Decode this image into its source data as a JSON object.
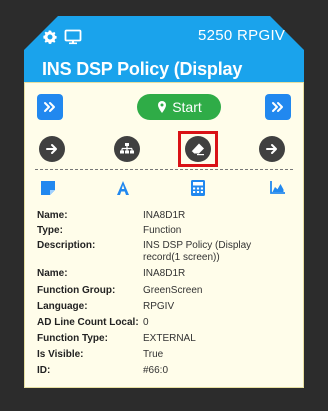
{
  "header": {
    "count": "5250",
    "program": "RPGIV",
    "title": "INS DSP Policy (Display"
  },
  "toolbar": {
    "start_label": "Start"
  },
  "metadata": [
    {
      "label": "Name:",
      "value": "INA8D1R"
    },
    {
      "label": "Type:",
      "value": "Function"
    },
    {
      "label": "Description:",
      "value": "INS DSP Policy (Display\nrecord(1 screen))"
    },
    {
      "label": "Name:",
      "value": "INA8D1R"
    },
    {
      "label": "Function Group:",
      "value": "GreenScreen"
    },
    {
      "label": "Language:",
      "value": "RPGIV"
    },
    {
      "label": "AD Line Count Local:",
      "value": "0"
    },
    {
      "label": "Function Type:",
      "value": "EXTERNAL"
    },
    {
      "label": "Is Visible:",
      "value": "True"
    },
    {
      "label": "ID:",
      "value": "#66:0"
    }
  ],
  "colors": {
    "header_blue": "#1aa3ec",
    "button_blue": "#2188ef",
    "start_green": "#2fac47",
    "highlight_red": "#d91216",
    "panel_bg": "#fffdea"
  }
}
